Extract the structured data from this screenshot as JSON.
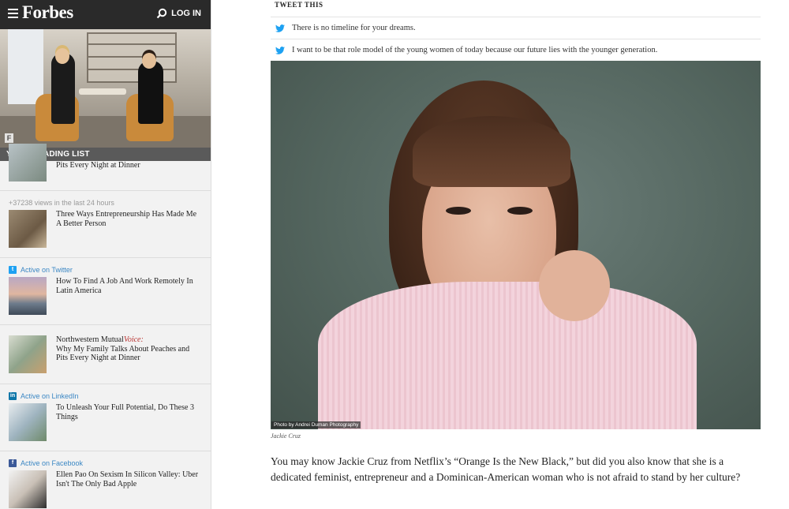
{
  "header": {
    "logo": "Forbes",
    "login_label": "LOG IN"
  },
  "sidebar": {
    "reading_list_title": "YOUR READING LIST",
    "partial_item_title": "Pits Every Night at Dinner",
    "items": [
      {
        "source": "+37238 views in the last 24 hours",
        "title": "Three Ways Entrepreneurship Has Made Me A Better Person"
      },
      {
        "source": "Active on Twitter",
        "title": "How To Find A Job And Work Remotely In Latin America"
      },
      {
        "brand": "Northwestern Mutual",
        "brand_suffix": "Voice:",
        "title": "Why My Family Talks About Peaches and Pits Every Night at Dinner"
      },
      {
        "source": "Active on LinkedIn",
        "title": "To Unleash Your Full Potential, Do These 3 Things"
      },
      {
        "source": "Active on Facebook",
        "title": "Ellen Pao On Sexism In Silicon Valley: Uber Isn't The Only Bad Apple"
      }
    ]
  },
  "article": {
    "tweet_heading": "TWEET THIS",
    "tweets": [
      "There is no timeline for your dreams.",
      "I want to be that role model of the young women of today because our future lies with the younger generation."
    ],
    "photo_credit": "Photo by Andrei Duman Photography",
    "caption": "Jackie Cruz",
    "paragraph": "You may know Jackie Cruz from Netflix’s “Orange Is the New Black,” but did you also know that she is a dedicated feminist, entrepreneur and a Dominican-American woman who is not afraid to stand by her culture?"
  },
  "colors": {
    "topbar": "#2a2a2a",
    "twitter_blue": "#1da1f2",
    "link_blue": "#3b87c4",
    "voice_red": "#b8312f"
  }
}
